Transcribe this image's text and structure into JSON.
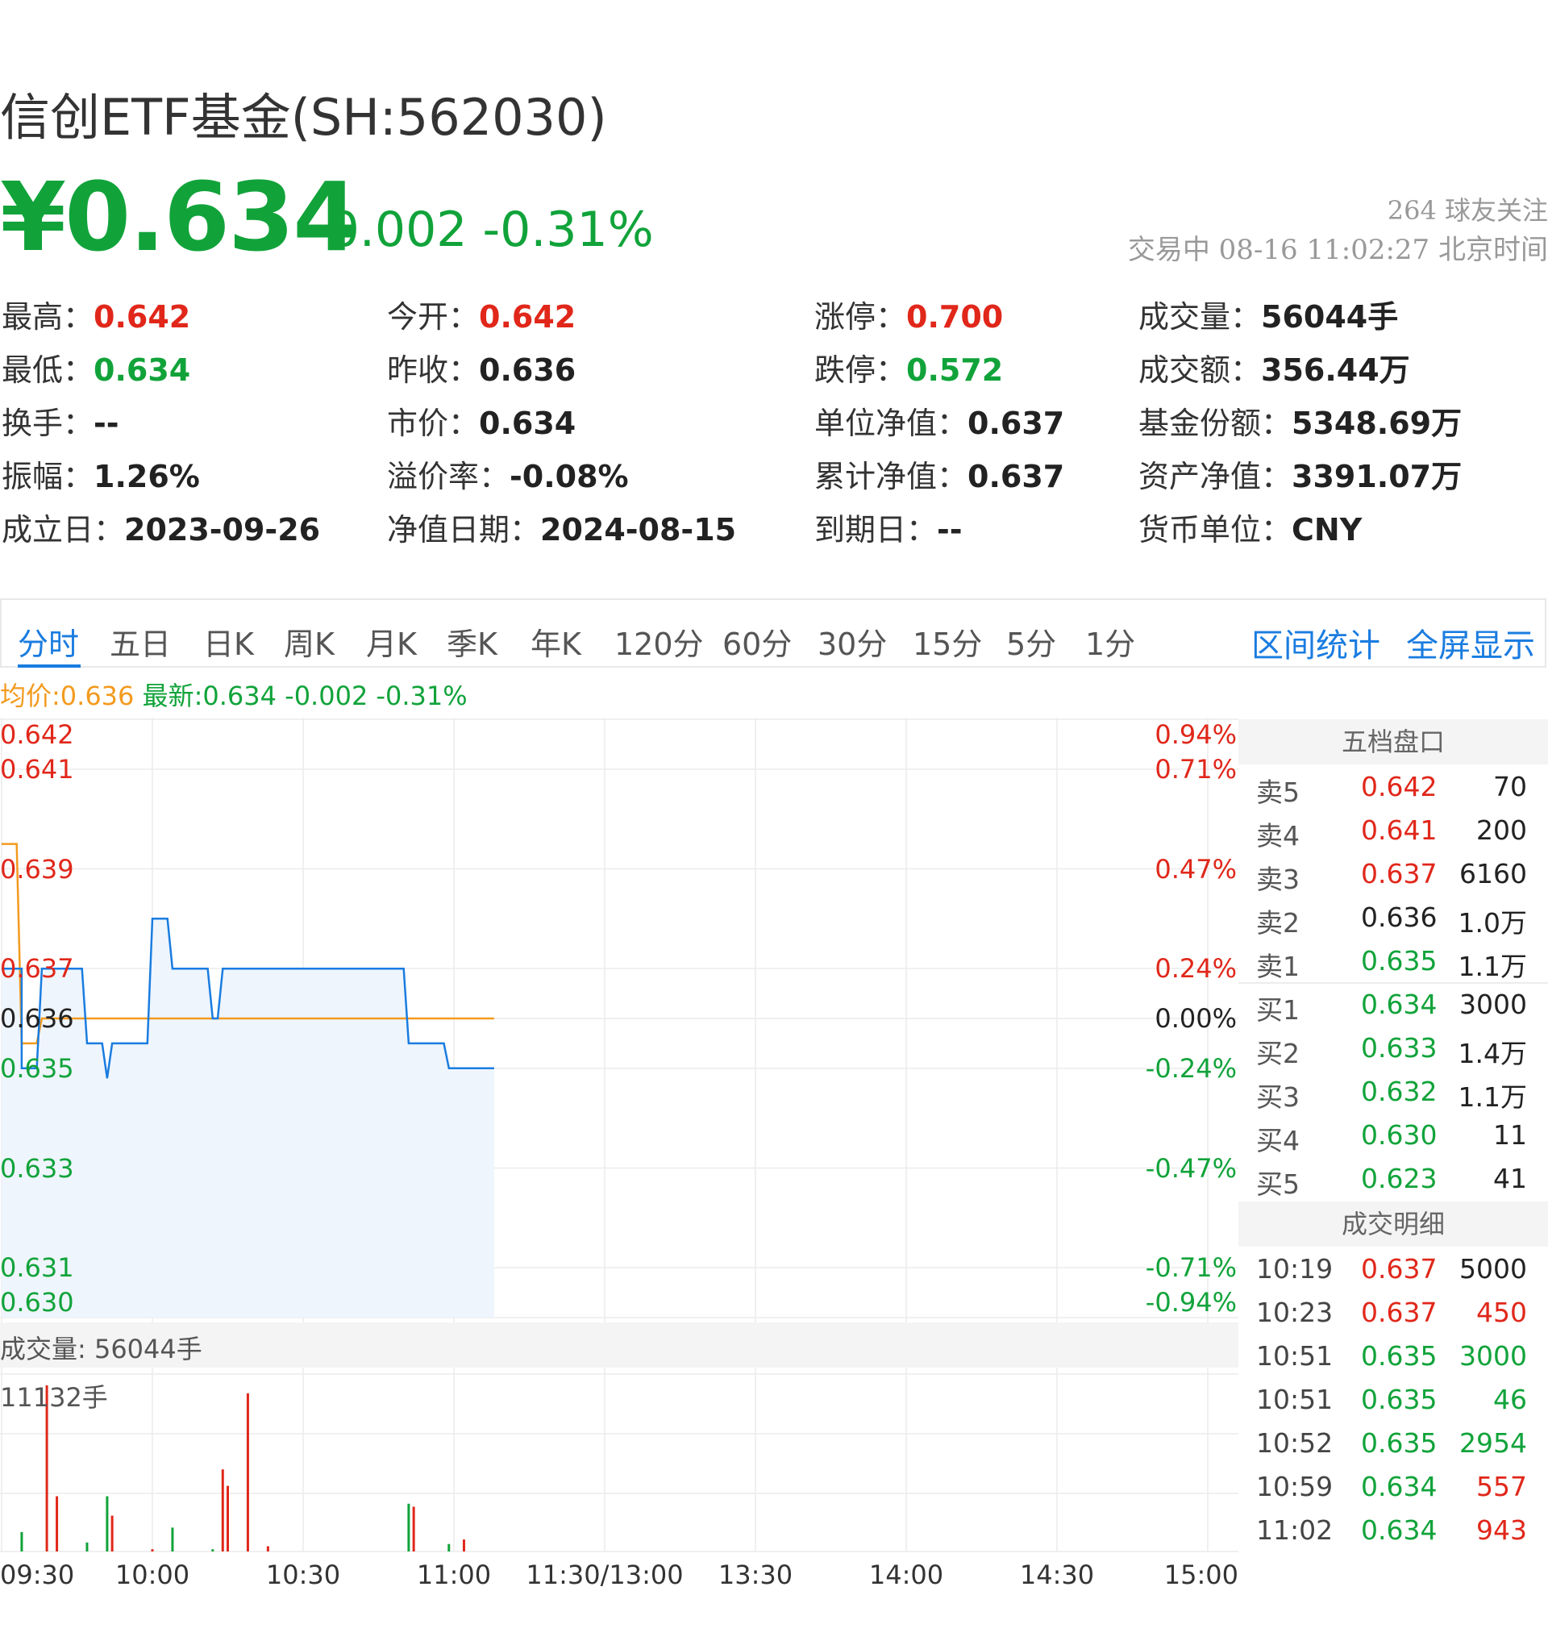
{
  "header": {
    "title": "信创ETF基金(SH:562030)",
    "price": "¥0.634",
    "change": "-0.002 -0.31%",
    "followers": "264 球友关注",
    "status": "交易中 08-16 11:02:27 北京时间"
  },
  "quote_grid": [
    [
      {
        "label": "最高：",
        "value": "0.642",
        "color": "red"
      },
      {
        "label": "今开：",
        "value": "0.642",
        "color": "red"
      },
      {
        "label": "涨停：",
        "value": "0.700",
        "color": "red"
      },
      {
        "label": "成交量：",
        "value": "56044手",
        "color": "dark"
      }
    ],
    [
      {
        "label": "最低：",
        "value": "0.634",
        "color": "green"
      },
      {
        "label": "昨收：",
        "value": "0.636",
        "color": "dark"
      },
      {
        "label": "跌停：",
        "value": "0.572",
        "color": "green"
      },
      {
        "label": "成交额：",
        "value": "356.44万",
        "color": "dark"
      }
    ],
    [
      {
        "label": "换手：",
        "value": "--",
        "color": "dark"
      },
      {
        "label": "市价：",
        "value": "0.634",
        "color": "dark"
      },
      {
        "label": "单位净值：",
        "value": "0.637",
        "color": "dark"
      },
      {
        "label": "基金份额：",
        "value": "5348.69万",
        "color": "dark"
      }
    ],
    [
      {
        "label": "振幅：",
        "value": "1.26%",
        "color": "dark"
      },
      {
        "label": "溢价率：",
        "value": "-0.08%",
        "color": "dark"
      },
      {
        "label": "累计净值：",
        "value": "0.637",
        "color": "dark"
      },
      {
        "label": "资产净值：",
        "value": "3391.07万",
        "color": "dark"
      }
    ],
    [
      {
        "label": "成立日：",
        "value": "2023-09-26",
        "color": "dark"
      },
      {
        "label": "净值日期：",
        "value": "2024-08-15",
        "color": "dark"
      },
      {
        "label": "到期日：",
        "value": "--",
        "color": "dark"
      },
      {
        "label": "货币单位：",
        "value": "CNY",
        "color": "dark"
      }
    ]
  ],
  "tabs": [
    "分时",
    "五日",
    "日K",
    "周K",
    "月K",
    "季K",
    "年K",
    "120分",
    "60分",
    "30分",
    "15分",
    "5分",
    "1分"
  ],
  "active_tab": "分时",
  "tab_links": [
    "区间统计",
    "全屏显示"
  ],
  "legend": {
    "avg": "均价:0.636",
    "latest": "最新:0.634 -0.002 -0.31%"
  },
  "volume": {
    "label": "成交量: 56044手",
    "max_label": "11132手"
  },
  "order_book": {
    "title": "五档盘口",
    "asks": [
      {
        "label": "卖5",
        "price": "0.642",
        "volume": "70",
        "color": "red"
      },
      {
        "label": "卖4",
        "price": "0.641",
        "volume": "200",
        "color": "red"
      },
      {
        "label": "卖3",
        "price": "0.637",
        "volume": "6160",
        "color": "red"
      },
      {
        "label": "卖2",
        "price": "0.636",
        "volume": "1.0万",
        "color": "dark"
      },
      {
        "label": "卖1",
        "price": "0.635",
        "volume": "1.1万",
        "color": "green"
      }
    ],
    "bids": [
      {
        "label": "买1",
        "price": "0.634",
        "volume": "3000",
        "color": "green"
      },
      {
        "label": "买2",
        "price": "0.633",
        "volume": "1.4万",
        "color": "green"
      },
      {
        "label": "买3",
        "price": "0.632",
        "volume": "1.1万",
        "color": "green"
      },
      {
        "label": "买4",
        "price": "0.630",
        "volume": "11",
        "color": "green"
      },
      {
        "label": "买5",
        "price": "0.623",
        "volume": "41",
        "color": "green"
      }
    ]
  },
  "trades": {
    "title": "成交明细",
    "rows": [
      {
        "time": "10:19",
        "price": "0.637",
        "volume": "5000",
        "pcolor": "red",
        "vcolor": "dark"
      },
      {
        "time": "10:23",
        "price": "0.637",
        "volume": "450",
        "pcolor": "red",
        "vcolor": "red"
      },
      {
        "time": "10:51",
        "price": "0.635",
        "volume": "3000",
        "pcolor": "green",
        "vcolor": "green"
      },
      {
        "time": "10:51",
        "price": "0.635",
        "volume": "46",
        "pcolor": "green",
        "vcolor": "green"
      },
      {
        "time": "10:52",
        "price": "0.635",
        "volume": "2954",
        "pcolor": "green",
        "vcolor": "green"
      },
      {
        "time": "10:59",
        "price": "0.634",
        "volume": "557",
        "pcolor": "green",
        "vcolor": "red"
      },
      {
        "time": "11:02",
        "price": "0.634",
        "volume": "943",
        "pcolor": "green",
        "vcolor": "red"
      }
    ]
  },
  "colors": {
    "up": "#e0271a",
    "down": "#11a33a",
    "line": "#1a7ce0",
    "avg": "#f39a1e",
    "fill": "#eef5fd",
    "grid": "#ececec"
  },
  "chart_data": {
    "type": "line",
    "prev_close": 0.636,
    "ylim": [
      0.63,
      0.642
    ],
    "y_ticks_left": [
      "0.642",
      "0.641",
      "0.639",
      "0.637",
      "0.636",
      "0.635",
      "0.633",
      "0.631",
      "0.630"
    ],
    "y_ticks_right": [
      "0.94%",
      "0.71%",
      "0.47%",
      "0.24%",
      "0.00%",
      "-0.24%",
      "-0.47%",
      "-0.71%",
      "-0.94%"
    ],
    "x_ticks": [
      "09:30",
      "10:00",
      "10:30",
      "11:00",
      "11:30/13:00",
      "13:30",
      "14:00",
      "14:30",
      "15:00"
    ],
    "total_minutes": 240,
    "series": [
      {
        "name": "最新",
        "points": [
          [
            0,
            0.637
          ],
          [
            4,
            0.637
          ],
          [
            4,
            0.635
          ],
          [
            7,
            0.635
          ],
          [
            8,
            0.637
          ],
          [
            16,
            0.637
          ],
          [
            17,
            0.6355
          ],
          [
            20,
            0.6355
          ],
          [
            21,
            0.6348
          ],
          [
            22,
            0.6355
          ],
          [
            29,
            0.6355
          ],
          [
            30,
            0.638
          ],
          [
            33,
            0.638
          ],
          [
            34,
            0.637
          ],
          [
            41,
            0.637
          ],
          [
            42,
            0.636
          ],
          [
            43,
            0.636
          ],
          [
            44,
            0.637
          ],
          [
            80,
            0.637
          ],
          [
            81,
            0.6355
          ],
          [
            88,
            0.6355
          ],
          [
            89,
            0.635
          ],
          [
            98,
            0.635
          ]
        ]
      },
      {
        "name": "均价",
        "points": [
          [
            0,
            0.6395
          ],
          [
            3,
            0.6395
          ],
          [
            4,
            0.6355
          ],
          [
            7,
            0.6355
          ],
          [
            8,
            0.636
          ],
          [
            98,
            0.636
          ]
        ]
      }
    ],
    "volume_series": {
      "max": 11132,
      "bars": [
        [
          4,
          1300,
          "green"
        ],
        [
          9,
          11132,
          "red"
        ],
        [
          11,
          3700,
          "red"
        ],
        [
          17,
          600,
          "green"
        ],
        [
          21,
          3700,
          "green"
        ],
        [
          22,
          2400,
          "red"
        ],
        [
          30,
          150,
          "red"
        ],
        [
          34,
          1600,
          "green"
        ],
        [
          42,
          150,
          "green"
        ],
        [
          44,
          5500,
          "red"
        ],
        [
          45,
          4400,
          "red"
        ],
        [
          49,
          10600,
          "red"
        ],
        [
          53,
          350,
          "red"
        ],
        [
          81,
          3200,
          "green"
        ],
        [
          82,
          3000,
          "red"
        ],
        [
          89,
          500,
          "green"
        ],
        [
          92,
          800,
          "red"
        ]
      ]
    }
  }
}
